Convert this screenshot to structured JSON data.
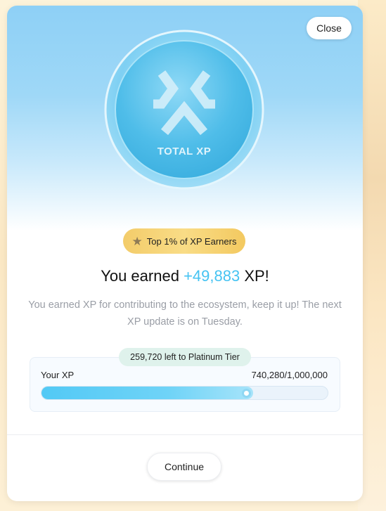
{
  "close_label": "Close",
  "coin": {
    "icon": "total-xp-logo-icon",
    "label": "TOTAL XP"
  },
  "badge": {
    "icon": "star-icon",
    "label": "Top 1% of XP Earners"
  },
  "headline": {
    "prefix": "You earned",
    "amount": "+49,883",
    "suffix": "XP!"
  },
  "description": "You earned XP for contributing to the ecosystem, keep it up! The next XP update is on Tuesday.",
  "progress": {
    "remaining_label": "259,720 left to Platinum Tier",
    "your_xp_label": "Your XP",
    "value_text": "740,280/1,000,000",
    "fraction": 0.74028
  },
  "continue_label": "Continue",
  "colors": {
    "accent": "#45c3f2",
    "badge": "#f3cc6a",
    "hero": "#8ed0f6"
  }
}
